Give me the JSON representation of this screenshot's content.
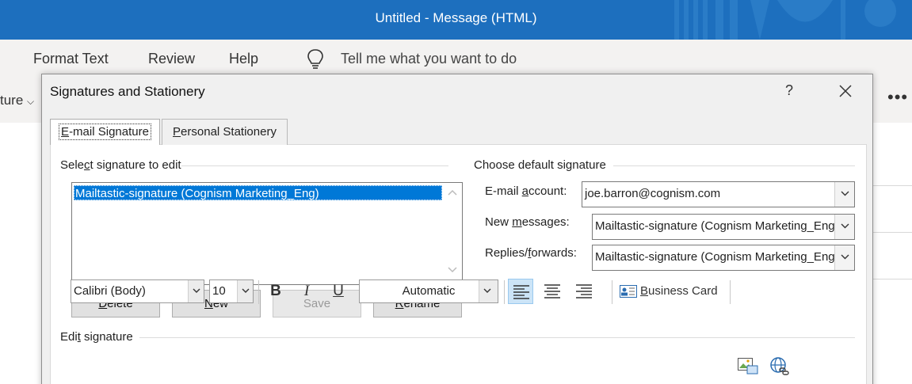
{
  "window": {
    "title": "Untitled  -  Message (HTML)"
  },
  "ribbon": {
    "menu": [
      "Format Text",
      "Review",
      "Help"
    ],
    "tell_me": "Tell me what you want to do",
    "partial_group": "ture",
    "more": "•••"
  },
  "dialog": {
    "title": "Signatures and Stationery",
    "help": "?",
    "tabs": [
      {
        "label": "E-mail Signature",
        "shortcut": "E",
        "rest": "-mail Signature"
      },
      {
        "label": "Personal Stationery",
        "shortcut": "P",
        "rest": "ersonal Stationery"
      }
    ],
    "select_group": {
      "pre": "Sele",
      "key": "c",
      "post": "t signature to edit"
    },
    "signatures": [
      "Mailtastic-signature (Cognism Marketing_Eng)"
    ],
    "buttons": {
      "delete": {
        "key": "D",
        "rest": "elete"
      },
      "new": {
        "key": "N",
        "rest": "ew"
      },
      "save": "Save",
      "rename": {
        "key": "R",
        "rest": "ename"
      }
    },
    "default_group": "Choose default signature",
    "email_account": {
      "pre": "E-mail ",
      "key": "a",
      "post": "ccount:",
      "value": "joe.barron@cognism.com"
    },
    "new_messages": {
      "pre": "New ",
      "key": "m",
      "post": "essages:",
      "value": "Mailtastic-signature (Cognism Marketing_Eng)"
    },
    "replies": {
      "pre": "Replies/",
      "key": "f",
      "post": "orwards:",
      "value": "Mailtastic-signature (Cognism Marketing_Eng)"
    },
    "edit_group": {
      "pre": "Edi",
      "key": "t",
      "post": " signature"
    },
    "toolbar": {
      "font": "Calibri (Body)",
      "size": "10",
      "bold": "B",
      "italic": "I",
      "underline": "U",
      "color": "Automatic",
      "business_card": {
        "key": "B",
        "rest": "usiness Card"
      }
    }
  },
  "colors": {
    "titlebar": "#1d6fbe",
    "selection": "#0078d7"
  }
}
